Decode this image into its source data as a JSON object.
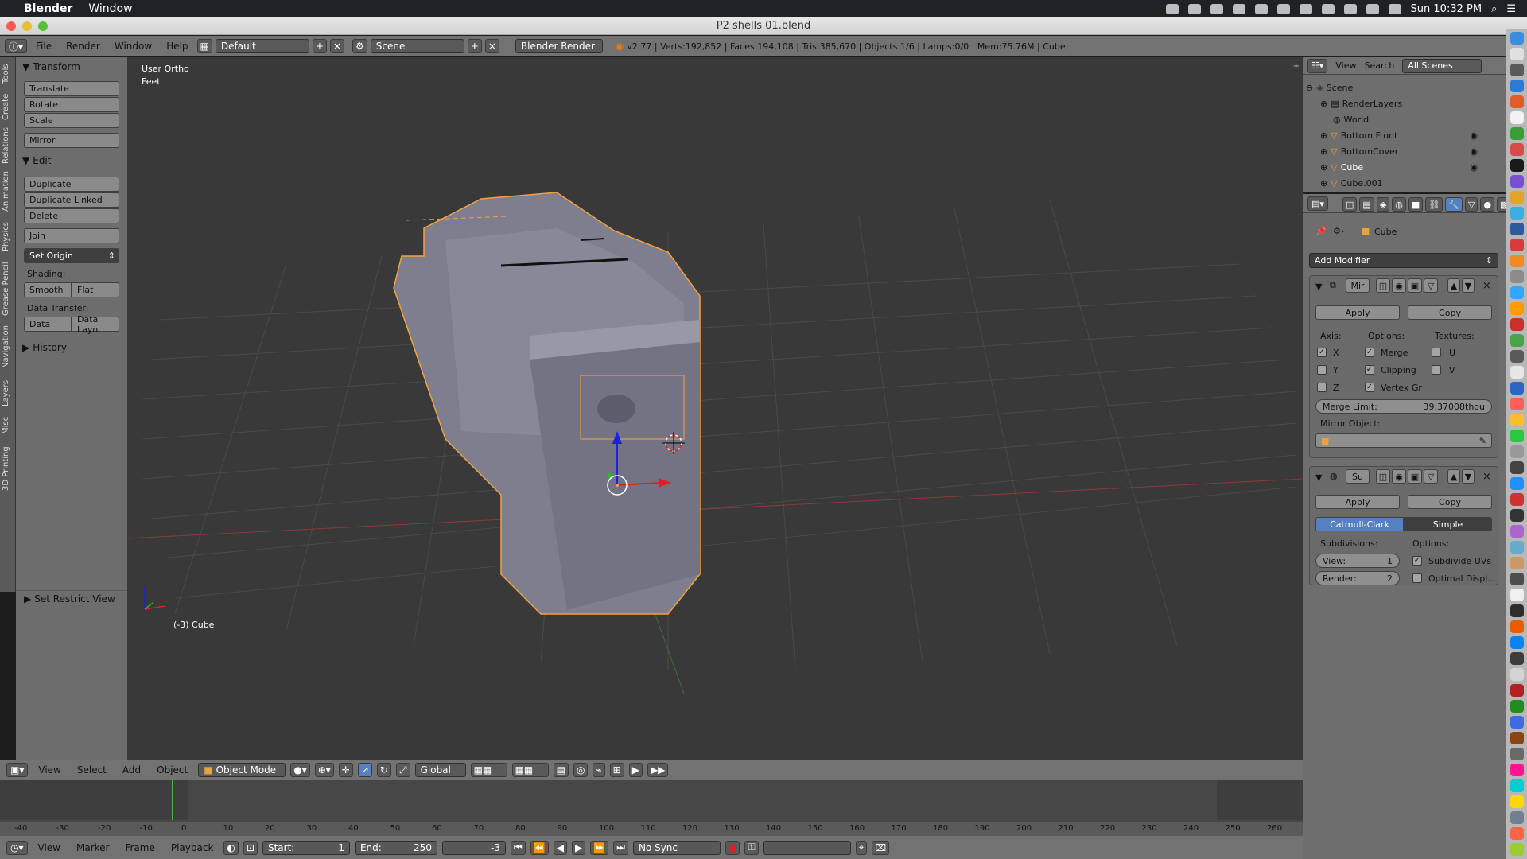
{
  "menubar": {
    "app_name": "Blender",
    "items": [
      "Window"
    ],
    "clock": "Sun 10:32 PM"
  },
  "window": {
    "title": "P2 shells 01.blend"
  },
  "info_header": {
    "menus": [
      "File",
      "Render",
      "Window",
      "Help"
    ],
    "layout": "Default",
    "scene": "Scene",
    "engine": "Blender Render",
    "stats": "v2.77 | Verts:192,852 | Faces:194,108 | Tris:385,670 | Objects:1/6 | Lamps:0/0 | Mem:75.76M | Cube"
  },
  "tabs": [
    "Tools",
    "Create",
    "Relations",
    "Animation",
    "Physics",
    "Grease Pencil",
    "Navigation",
    "Layers",
    "Misc",
    "3D Printing"
  ],
  "toolshelf": {
    "transform": {
      "title": "Transform",
      "buttons": [
        "Translate",
        "Rotate",
        "Scale",
        "Mirror"
      ]
    },
    "edit": {
      "title": "Edit",
      "buttons": [
        "Duplicate",
        "Duplicate Linked",
        "Delete",
        "Join"
      ],
      "set_origin": "Set Origin",
      "shading_label": "Shading:",
      "smooth": "Smooth",
      "flat": "Flat",
      "data_transfer_label": "Data Transfer:",
      "data": "Data",
      "data_layo": "Data Layo"
    },
    "history": "History",
    "restrict": "Set Restrict View"
  },
  "viewport": {
    "view_name": "User Ortho",
    "units": "Feet",
    "object_label": "(-3) Cube"
  },
  "vp_header": {
    "menus": [
      "View",
      "Select",
      "Add",
      "Object"
    ],
    "mode": "Object Mode",
    "orientation": "Global"
  },
  "timeline": {
    "ticks": [
      "-40",
      "-30",
      "-20",
      "-10",
      "0",
      "10",
      "20",
      "30",
      "40",
      "50",
      "60",
      "70",
      "80",
      "90",
      "100",
      "110",
      "120",
      "130",
      "140",
      "150",
      "160",
      "170",
      "180",
      "190",
      "200",
      "210",
      "220",
      "230",
      "240",
      "250",
      "260"
    ],
    "current_frame": 0
  },
  "tl_header": {
    "menus": [
      "View",
      "Marker",
      "Frame",
      "Playback"
    ],
    "start_label": "Start:",
    "start": "1",
    "end_label": "End:",
    "end": "250",
    "current": "-3",
    "sync": "No Sync"
  },
  "outliner": {
    "menus": [
      "View",
      "Search"
    ],
    "filter": "All Scenes",
    "rows": [
      "Scene",
      "RenderLayers",
      "World",
      "Bottom Front",
      "BottomCover",
      "Cube",
      "Cube.001"
    ]
  },
  "properties": {
    "object": "Cube",
    "add_modifier": "Add Modifier",
    "mirror": {
      "name": "Mir",
      "apply": "Apply",
      "copy": "Copy",
      "axis_label": "Axis:",
      "options_label": "Options:",
      "textures_label": "Textures:",
      "x": "X",
      "y": "Y",
      "z": "Z",
      "merge": "Merge",
      "clipping": "Clipping",
      "vertex_gr": "Vertex Gr",
      "u": "U",
      "v": "V",
      "merge_limit": "Merge Limit:",
      "merge_limit_value": "39.37008thou",
      "mirror_object": "Mirror Object:"
    },
    "subsurf": {
      "name": "Su",
      "apply": "Apply",
      "copy": "Copy",
      "catmull": "Catmull-Clark",
      "simple": "Simple",
      "subdivisions": "Subdivisions:",
      "options": "Options:",
      "view_label": "View:",
      "view_value": "1",
      "render_label": "Render:",
      "render_value": "2",
      "subdivide_uvs": "Subdivide UVs",
      "optimal": "Optimal Displ..."
    }
  },
  "colors": {
    "accent": "#5680c2",
    "selection": "#f1a340",
    "x_axis": "#e02020",
    "y_axis": "#20c020",
    "z_axis": "#2020e0"
  }
}
